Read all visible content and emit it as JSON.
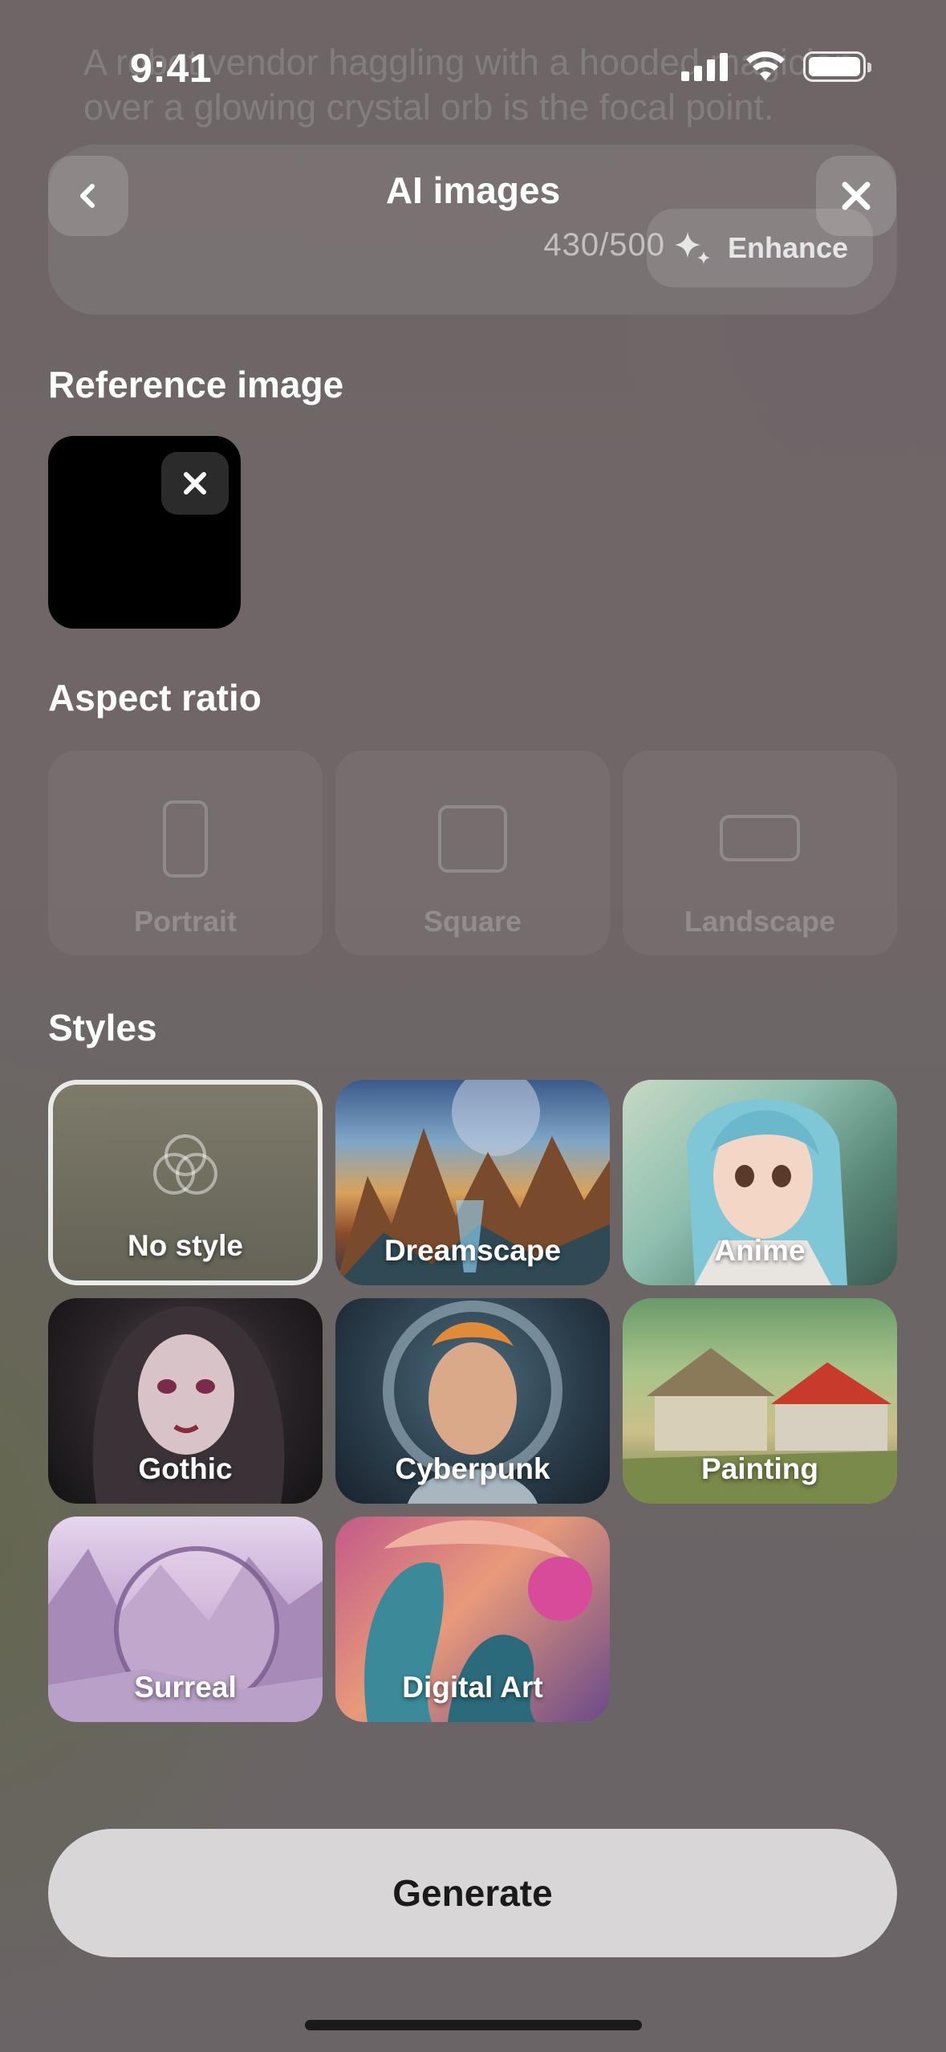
{
  "status_bar": {
    "time": "9:41"
  },
  "background_prompt": "A robot vendor haggling with a hooded magician over a glowing crystal orb is the focal point.",
  "prompt": {
    "counter": "430/500",
    "enhance_label": "Enhance"
  },
  "header": {
    "title": "AI images"
  },
  "reference_image": {
    "section_title": "Reference image"
  },
  "aspect_ratio": {
    "section_title": "Aspect ratio",
    "options": [
      {
        "label": "Portrait"
      },
      {
        "label": "Square"
      },
      {
        "label": "Landscape"
      }
    ]
  },
  "styles": {
    "section_title": "Styles",
    "items": [
      {
        "label": "No style",
        "selected": true
      },
      {
        "label": "Dreamscape"
      },
      {
        "label": "Anime"
      },
      {
        "label": "Gothic"
      },
      {
        "label": "Cyberpunk"
      },
      {
        "label": "Painting"
      },
      {
        "label": "Surreal"
      },
      {
        "label": "Digital Art"
      }
    ]
  },
  "generate_label": "Generate"
}
